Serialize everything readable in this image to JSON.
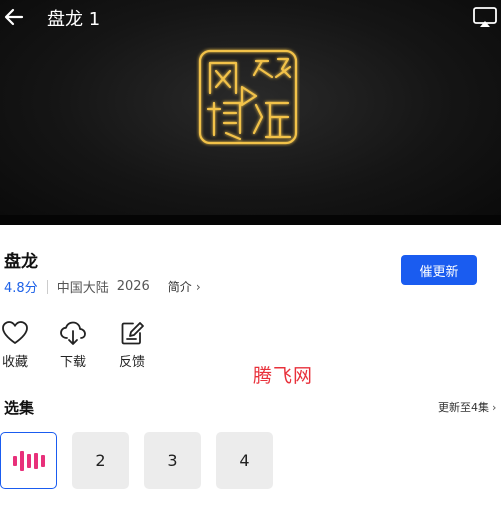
{
  "player": {
    "title": "盘龙 1",
    "logo_icon": "wangluo-shiting-seal-logo",
    "back_icon": "arrow-left-icon",
    "cast_icon": "cast-screen-icon"
  },
  "show": {
    "title": "盘龙",
    "score": "4.8分",
    "region": "中国大陆",
    "year": "2026",
    "intro_label": "简介",
    "intro_chevron": "›",
    "remind_button": "催更新"
  },
  "actions": [
    {
      "label": "收藏",
      "icon": "heart-icon"
    },
    {
      "label": "下载",
      "icon": "cloud-download-icon"
    },
    {
      "label": "反馈",
      "icon": "edit-feedback-icon"
    }
  ],
  "watermark": "腾飞网",
  "episodes": {
    "title": "选集",
    "update_text": "更新至4集",
    "update_chevron": "›",
    "items": [
      {
        "label": "",
        "playing": true
      },
      {
        "label": "2"
      },
      {
        "label": "3"
      },
      {
        "label": "4"
      }
    ]
  },
  "colors": {
    "accent": "#1a5cf0",
    "score": "#1e62e8",
    "playing": "#e8307a",
    "watermark": "#e8303a",
    "logo_gold": "#f2c24a"
  }
}
